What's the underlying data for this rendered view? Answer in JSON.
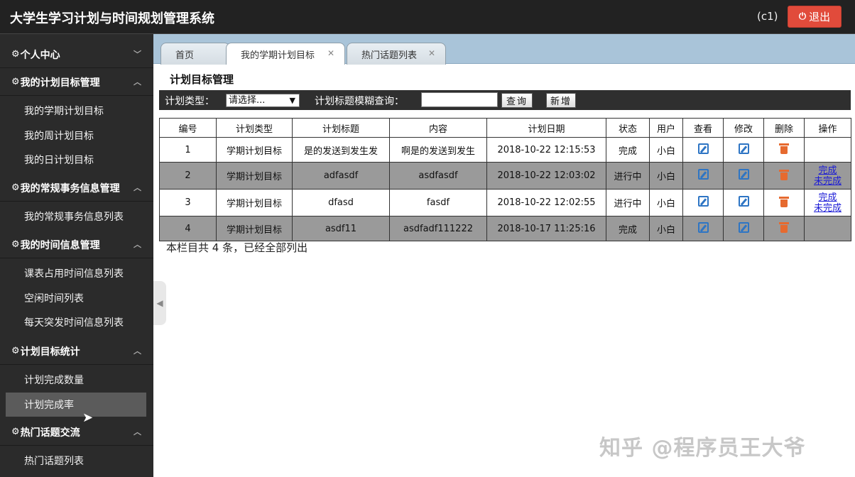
{
  "header": {
    "title": "大学生学习计划与时间规划管理系统",
    "user": "(c1)",
    "logout_label": "退出"
  },
  "sidebar": {
    "sections": [
      {
        "label": "个人中心",
        "items": []
      },
      {
        "label": "我的计划目标管理",
        "items": [
          "我的学期计划目标",
          "我的周计划目标",
          "我的日计划目标"
        ]
      },
      {
        "label": "我的常规事务信息管理",
        "items": [
          "我的常规事务信息列表"
        ]
      },
      {
        "label": "我的时间信息管理",
        "items": [
          "课表占用时间信息列表",
          "空闲时间列表",
          "每天突发时间信息列表"
        ]
      },
      {
        "label": "计划目标统计",
        "items": [
          "计划完成数量",
          "计划完成率"
        ]
      },
      {
        "label": "热门话题交流",
        "items": [
          "热门话题列表"
        ]
      }
    ],
    "active_item": "计划完成率"
  },
  "tabs": [
    {
      "label": "首页"
    },
    {
      "label": "我的学期计划目标"
    },
    {
      "label": "热门话题列表"
    }
  ],
  "main": {
    "title": "计划目标管理",
    "filters": {
      "type_label": "计划类型：",
      "type_value": "请选择...",
      "title_label": "计划标题模糊查询：",
      "title_value": "",
      "query_label": "查询",
      "add_label": "新增"
    },
    "table": {
      "headers": [
        "编号",
        "计划类型",
        "计划标题",
        "内容",
        "计划日期",
        "状态",
        "用户",
        "查看",
        "修改",
        "删除",
        "操作"
      ],
      "rows": [
        {
          "id": "1",
          "type": "学期计划目标",
          "title": "是的发送到发生发",
          "content": "啊是的发送到发生",
          "date": "2018-10-22 12:15:53",
          "status": "完成",
          "user": "小白",
          "ops": []
        },
        {
          "id": "2",
          "type": "学期计划目标",
          "title": "adfasdf",
          "content": "asdfasdf",
          "date": "2018-10-22 12:03:02",
          "status": "进行中",
          "user": "小白",
          "ops": [
            "完成",
            "未完成"
          ]
        },
        {
          "id": "3",
          "type": "学期计划目标",
          "title": "dfasd",
          "content": "fasdf",
          "date": "2018-10-22 12:02:55",
          "status": "进行中",
          "user": "小白",
          "ops": [
            "完成",
            "未完成"
          ]
        },
        {
          "id": "4",
          "type": "学期计划目标",
          "title": "asdf11",
          "content": "asdfadf111222",
          "date": "2018-10-17 11:25:16",
          "status": "完成",
          "user": "小白",
          "ops": []
        }
      ]
    },
    "summary": "本栏目共 4 条，已经全部列出"
  },
  "watermark": "知乎 @程序员王大爷",
  "colors": {
    "header_bg": "#222222",
    "sidebar_bg": "#2b2b2b",
    "logout_bg": "#e14b3b",
    "tabbar_bg": "#a9c4d9",
    "even_row_bg": "#9a9a9a",
    "link": "#1a1ad6"
  },
  "icons": {
    "section": "gear-icon",
    "view": "edit-icon",
    "edit": "edit-icon",
    "delete": "trash-icon",
    "logout": "power-icon"
  }
}
